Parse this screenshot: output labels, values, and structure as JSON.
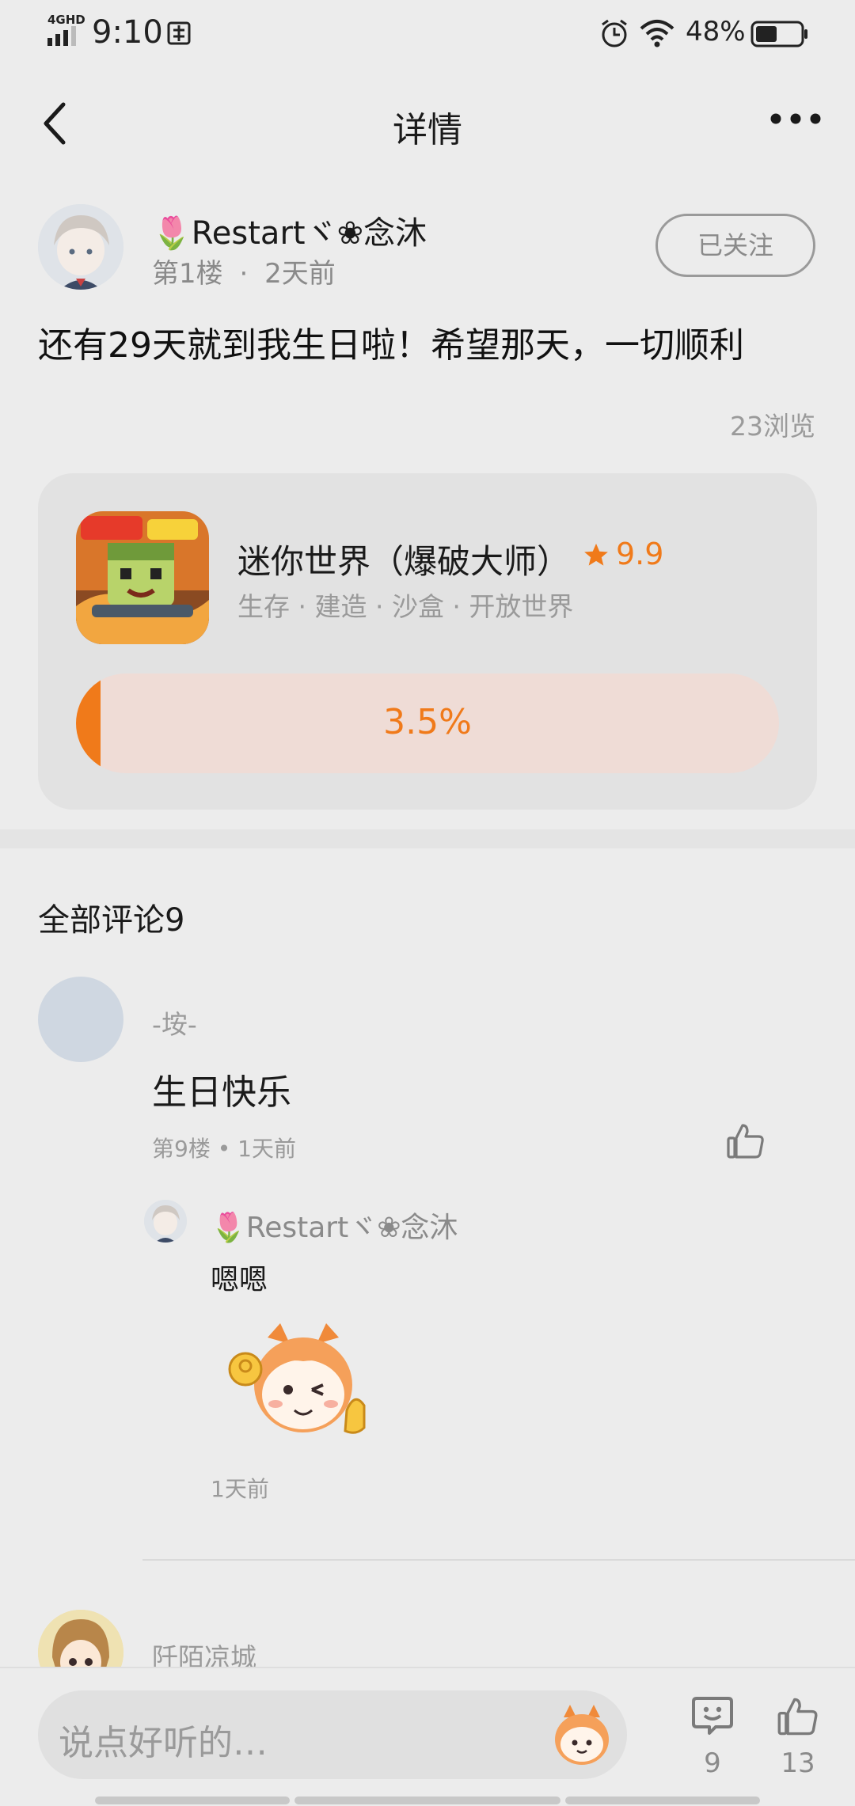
{
  "status_bar": {
    "network": "4GHD",
    "time": "9:10",
    "battery_percent": "48%"
  },
  "header": {
    "title": "详情"
  },
  "post": {
    "username": "🌷Restartヾ❀念沐",
    "floor": "第1楼",
    "time_ago": "2天前",
    "follow_label": "已关注",
    "text": "还有29天就到我生日啦！希望那天，一切顺利",
    "views": "23浏览"
  },
  "game": {
    "name": "迷你世界（爆破大师）",
    "rating": "9.9",
    "tags": "生存 · 建造 · 沙盒 · 开放世界",
    "progress_label": "3.5%",
    "progress_value": 0.035,
    "accent_color": "#f07a1a"
  },
  "comments": {
    "title": "全部评论9",
    "items": [
      {
        "name": "-垵-",
        "text": "生日快乐",
        "meta": "第9楼 • 1天前",
        "reply": {
          "name": "🌷Restartヾ❀念沐",
          "text": "嗯嗯",
          "time": "1天前"
        }
      },
      {
        "name": "阡陌凉城"
      }
    ]
  },
  "bottom_bar": {
    "input_placeholder": "说点好听的…",
    "comment_count": "9",
    "like_count": "13"
  }
}
